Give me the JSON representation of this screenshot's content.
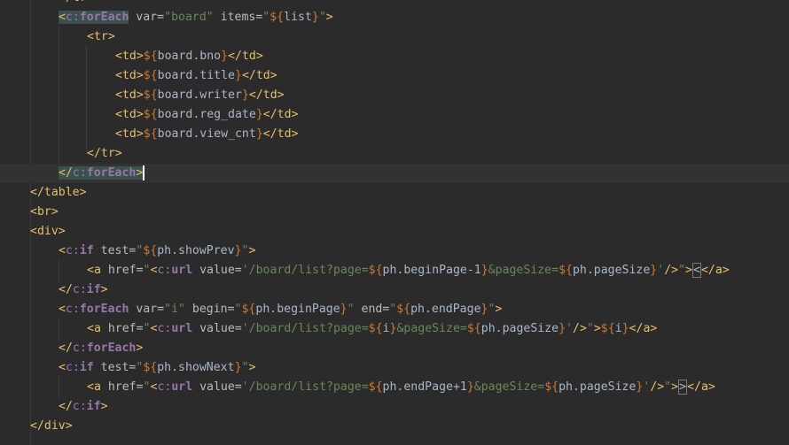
{
  "editor": {
    "lines": [
      {
        "id": "l0",
        "indent": 2,
        "tokens": [
          {
            "t": "</tr>",
            "c": "tag"
          }
        ]
      },
      {
        "id": "l1",
        "indent": 2,
        "tokens": [
          {
            "t": "<",
            "c": "tag hl"
          },
          {
            "t": "c:",
            "c": "ns hl"
          },
          {
            "t": "forEach",
            "c": "ns bold hl"
          },
          {
            "t": " var=",
            "c": "attr"
          },
          {
            "t": "\"board\"",
            "c": "val"
          },
          {
            "t": " items=",
            "c": "attr"
          },
          {
            "t": "\"",
            "c": "val"
          },
          {
            "t": "${",
            "c": "el"
          },
          {
            "t": "list",
            "c": "expr"
          },
          {
            "t": "}",
            "c": "el"
          },
          {
            "t": "\"",
            "c": "val"
          },
          {
            "t": ">",
            "c": "tag"
          }
        ]
      },
      {
        "id": "l2",
        "indent": 3,
        "tokens": [
          {
            "t": "<tr>",
            "c": "tag"
          }
        ]
      },
      {
        "id": "l3",
        "indent": 4,
        "tokens": [
          {
            "t": "<td>",
            "c": "tag"
          },
          {
            "t": "${",
            "c": "el"
          },
          {
            "t": "board.bno",
            "c": "expr"
          },
          {
            "t": "}",
            "c": "el"
          },
          {
            "t": "</td>",
            "c": "tag"
          }
        ]
      },
      {
        "id": "l4",
        "indent": 4,
        "tokens": [
          {
            "t": "<td>",
            "c": "tag"
          },
          {
            "t": "${",
            "c": "el"
          },
          {
            "t": "board.title",
            "c": "expr"
          },
          {
            "t": "}",
            "c": "el"
          },
          {
            "t": "</td>",
            "c": "tag"
          }
        ]
      },
      {
        "id": "l5",
        "indent": 4,
        "tokens": [
          {
            "t": "<td>",
            "c": "tag"
          },
          {
            "t": "${",
            "c": "el"
          },
          {
            "t": "board.writer",
            "c": "expr"
          },
          {
            "t": "}",
            "c": "el"
          },
          {
            "t": "</td>",
            "c": "tag"
          }
        ]
      },
      {
        "id": "l6",
        "indent": 4,
        "tokens": [
          {
            "t": "<td>",
            "c": "tag"
          },
          {
            "t": "${",
            "c": "el"
          },
          {
            "t": "board.reg_date",
            "c": "expr"
          },
          {
            "t": "}",
            "c": "el"
          },
          {
            "t": "</td>",
            "c": "tag"
          }
        ]
      },
      {
        "id": "l7",
        "indent": 4,
        "tokens": [
          {
            "t": "<td>",
            "c": "tag"
          },
          {
            "t": "${",
            "c": "el"
          },
          {
            "t": "board.view_cnt",
            "c": "expr"
          },
          {
            "t": "}",
            "c": "el"
          },
          {
            "t": "</td>",
            "c": "tag"
          }
        ]
      },
      {
        "id": "l8",
        "indent": 3,
        "tokens": [
          {
            "t": "</tr>",
            "c": "tag"
          }
        ]
      },
      {
        "id": "l9",
        "indent": 2,
        "current": true,
        "tokens": [
          {
            "t": "</",
            "c": "tag hl"
          },
          {
            "t": "c:",
            "c": "ns hl"
          },
          {
            "t": "forEach",
            "c": "ns bold hl"
          },
          {
            "t": ">",
            "c": "tag hl"
          },
          {
            "t": "",
            "c": "caret"
          }
        ]
      },
      {
        "id": "l10",
        "indent": 1,
        "tokens": [
          {
            "t": "</table>",
            "c": "tag"
          }
        ]
      },
      {
        "id": "l11",
        "indent": 1,
        "tokens": [
          {
            "t": "<br>",
            "c": "tag"
          }
        ]
      },
      {
        "id": "l12",
        "indent": 1,
        "tokens": [
          {
            "t": "<div>",
            "c": "tag"
          }
        ]
      },
      {
        "id": "l13",
        "indent": 2,
        "tokens": [
          {
            "t": "<",
            "c": "tag"
          },
          {
            "t": "c:",
            "c": "ns"
          },
          {
            "t": "if",
            "c": "ns bold"
          },
          {
            "t": " test=",
            "c": "attr"
          },
          {
            "t": "\"",
            "c": "val"
          },
          {
            "t": "${",
            "c": "el"
          },
          {
            "t": "ph.showPrev",
            "c": "expr"
          },
          {
            "t": "}",
            "c": "el"
          },
          {
            "t": "\"",
            "c": "val"
          },
          {
            "t": ">",
            "c": "tag"
          }
        ]
      },
      {
        "id": "l14",
        "indent": 3,
        "tokens": [
          {
            "t": "<a",
            "c": "tag"
          },
          {
            "t": " href=",
            "c": "attr"
          },
          {
            "t": "\"",
            "c": "val"
          },
          {
            "t": "<",
            "c": "tag"
          },
          {
            "t": "c:",
            "c": "ns"
          },
          {
            "t": "url",
            "c": "ns bold"
          },
          {
            "t": " value=",
            "c": "attr"
          },
          {
            "t": "'/board/list?page=",
            "c": "val"
          },
          {
            "t": "${",
            "c": "el"
          },
          {
            "t": "ph.beginPage-1",
            "c": "expr"
          },
          {
            "t": "}",
            "c": "el"
          },
          {
            "t": "&pageSize=",
            "c": "val"
          },
          {
            "t": "${",
            "c": "el"
          },
          {
            "t": "ph.pageSize",
            "c": "expr"
          },
          {
            "t": "}",
            "c": "el"
          },
          {
            "t": "'",
            "c": "val"
          },
          {
            "t": "/>",
            "c": "tag"
          },
          {
            "t": "\"",
            "c": "val"
          },
          {
            "t": ">",
            "c": "tag"
          },
          {
            "t": "<",
            "c": "expr selbox"
          },
          {
            "t": "</a>",
            "c": "tag"
          }
        ]
      },
      {
        "id": "l15",
        "indent": 2,
        "tokens": [
          {
            "t": "</",
            "c": "tag"
          },
          {
            "t": "c:",
            "c": "ns"
          },
          {
            "t": "if",
            "c": "ns bold"
          },
          {
            "t": ">",
            "c": "tag"
          }
        ]
      },
      {
        "id": "l16",
        "indent": 2,
        "tokens": [
          {
            "t": "<",
            "c": "tag"
          },
          {
            "t": "c:",
            "c": "ns"
          },
          {
            "t": "forEach",
            "c": "ns bold"
          },
          {
            "t": " var=",
            "c": "attr"
          },
          {
            "t": "\"i\"",
            "c": "val"
          },
          {
            "t": " begin=",
            "c": "attr"
          },
          {
            "t": "\"",
            "c": "val"
          },
          {
            "t": "${",
            "c": "el"
          },
          {
            "t": "ph.beginPage",
            "c": "expr"
          },
          {
            "t": "}",
            "c": "el"
          },
          {
            "t": "\"",
            "c": "val"
          },
          {
            "t": " end=",
            "c": "attr"
          },
          {
            "t": "\"",
            "c": "val"
          },
          {
            "t": "${",
            "c": "el"
          },
          {
            "t": "ph.endPage",
            "c": "expr"
          },
          {
            "t": "}",
            "c": "el"
          },
          {
            "t": "\"",
            "c": "val"
          },
          {
            "t": ">",
            "c": "tag"
          }
        ]
      },
      {
        "id": "l17",
        "indent": 3,
        "tokens": [
          {
            "t": "<a",
            "c": "tag"
          },
          {
            "t": " href=",
            "c": "attr"
          },
          {
            "t": "\"",
            "c": "val"
          },
          {
            "t": "<",
            "c": "tag"
          },
          {
            "t": "c:",
            "c": "ns"
          },
          {
            "t": "url",
            "c": "ns bold"
          },
          {
            "t": " value=",
            "c": "attr"
          },
          {
            "t": "'/board/list?page=",
            "c": "val"
          },
          {
            "t": "${",
            "c": "el"
          },
          {
            "t": "i",
            "c": "expr"
          },
          {
            "t": "}",
            "c": "el"
          },
          {
            "t": "&pageSize=",
            "c": "val"
          },
          {
            "t": "${",
            "c": "el"
          },
          {
            "t": "ph.pageSize",
            "c": "expr"
          },
          {
            "t": "}",
            "c": "el"
          },
          {
            "t": "'",
            "c": "val"
          },
          {
            "t": "/>",
            "c": "tag"
          },
          {
            "t": "\"",
            "c": "val"
          },
          {
            "t": ">",
            "c": "tag"
          },
          {
            "t": "${",
            "c": "el"
          },
          {
            "t": "i",
            "c": "expr"
          },
          {
            "t": "}",
            "c": "el"
          },
          {
            "t": "</a>",
            "c": "tag"
          }
        ]
      },
      {
        "id": "l18",
        "indent": 2,
        "tokens": [
          {
            "t": "</",
            "c": "tag"
          },
          {
            "t": "c:",
            "c": "ns"
          },
          {
            "t": "forEach",
            "c": "ns bold"
          },
          {
            "t": ">",
            "c": "tag"
          }
        ]
      },
      {
        "id": "l19",
        "indent": 2,
        "tokens": [
          {
            "t": "<",
            "c": "tag"
          },
          {
            "t": "c:",
            "c": "ns"
          },
          {
            "t": "if",
            "c": "ns bold"
          },
          {
            "t": " test=",
            "c": "attr"
          },
          {
            "t": "\"",
            "c": "val"
          },
          {
            "t": "${",
            "c": "el"
          },
          {
            "t": "ph.showNext",
            "c": "expr"
          },
          {
            "t": "}",
            "c": "el"
          },
          {
            "t": "\"",
            "c": "val"
          },
          {
            "t": ">",
            "c": "tag"
          }
        ]
      },
      {
        "id": "l20",
        "indent": 3,
        "tokens": [
          {
            "t": "<a",
            "c": "tag"
          },
          {
            "t": " href=",
            "c": "attr"
          },
          {
            "t": "\"",
            "c": "val"
          },
          {
            "t": "<",
            "c": "tag"
          },
          {
            "t": "c:",
            "c": "ns"
          },
          {
            "t": "url",
            "c": "ns bold"
          },
          {
            "t": " value=",
            "c": "attr"
          },
          {
            "t": "'/board/list?page=",
            "c": "val"
          },
          {
            "t": "${",
            "c": "el"
          },
          {
            "t": "ph.endPage+1",
            "c": "expr"
          },
          {
            "t": "}",
            "c": "el"
          },
          {
            "t": "&pageSize=",
            "c": "val"
          },
          {
            "t": "${",
            "c": "el"
          },
          {
            "t": "ph.pageSize",
            "c": "expr"
          },
          {
            "t": "}",
            "c": "el"
          },
          {
            "t": "'",
            "c": "val"
          },
          {
            "t": "/>",
            "c": "tag"
          },
          {
            "t": "\"",
            "c": "val"
          },
          {
            "t": ">",
            "c": "tag"
          },
          {
            "t": ">",
            "c": "expr selbox"
          },
          {
            "t": "</a>",
            "c": "tag"
          }
        ]
      },
      {
        "id": "l21",
        "indent": 2,
        "tokens": [
          {
            "t": "</",
            "c": "tag"
          },
          {
            "t": "c:",
            "c": "ns"
          },
          {
            "t": "if",
            "c": "ns bold"
          },
          {
            "t": ">",
            "c": "tag"
          }
        ]
      },
      {
        "id": "l22",
        "indent": 1,
        "tokens": [
          {
            "t": "</div>",
            "c": "tag"
          }
        ]
      }
    ]
  },
  "colors": {
    "background": "#2b2b2b",
    "current_line": "#323232",
    "tag": "#e8bf6a",
    "namespace": "#9876aa",
    "attribute": "#bababa",
    "string": "#6a8759",
    "el_delimiter": "#cc7832",
    "plain": "#a9b7c6",
    "match_highlight": "#3b514d"
  }
}
